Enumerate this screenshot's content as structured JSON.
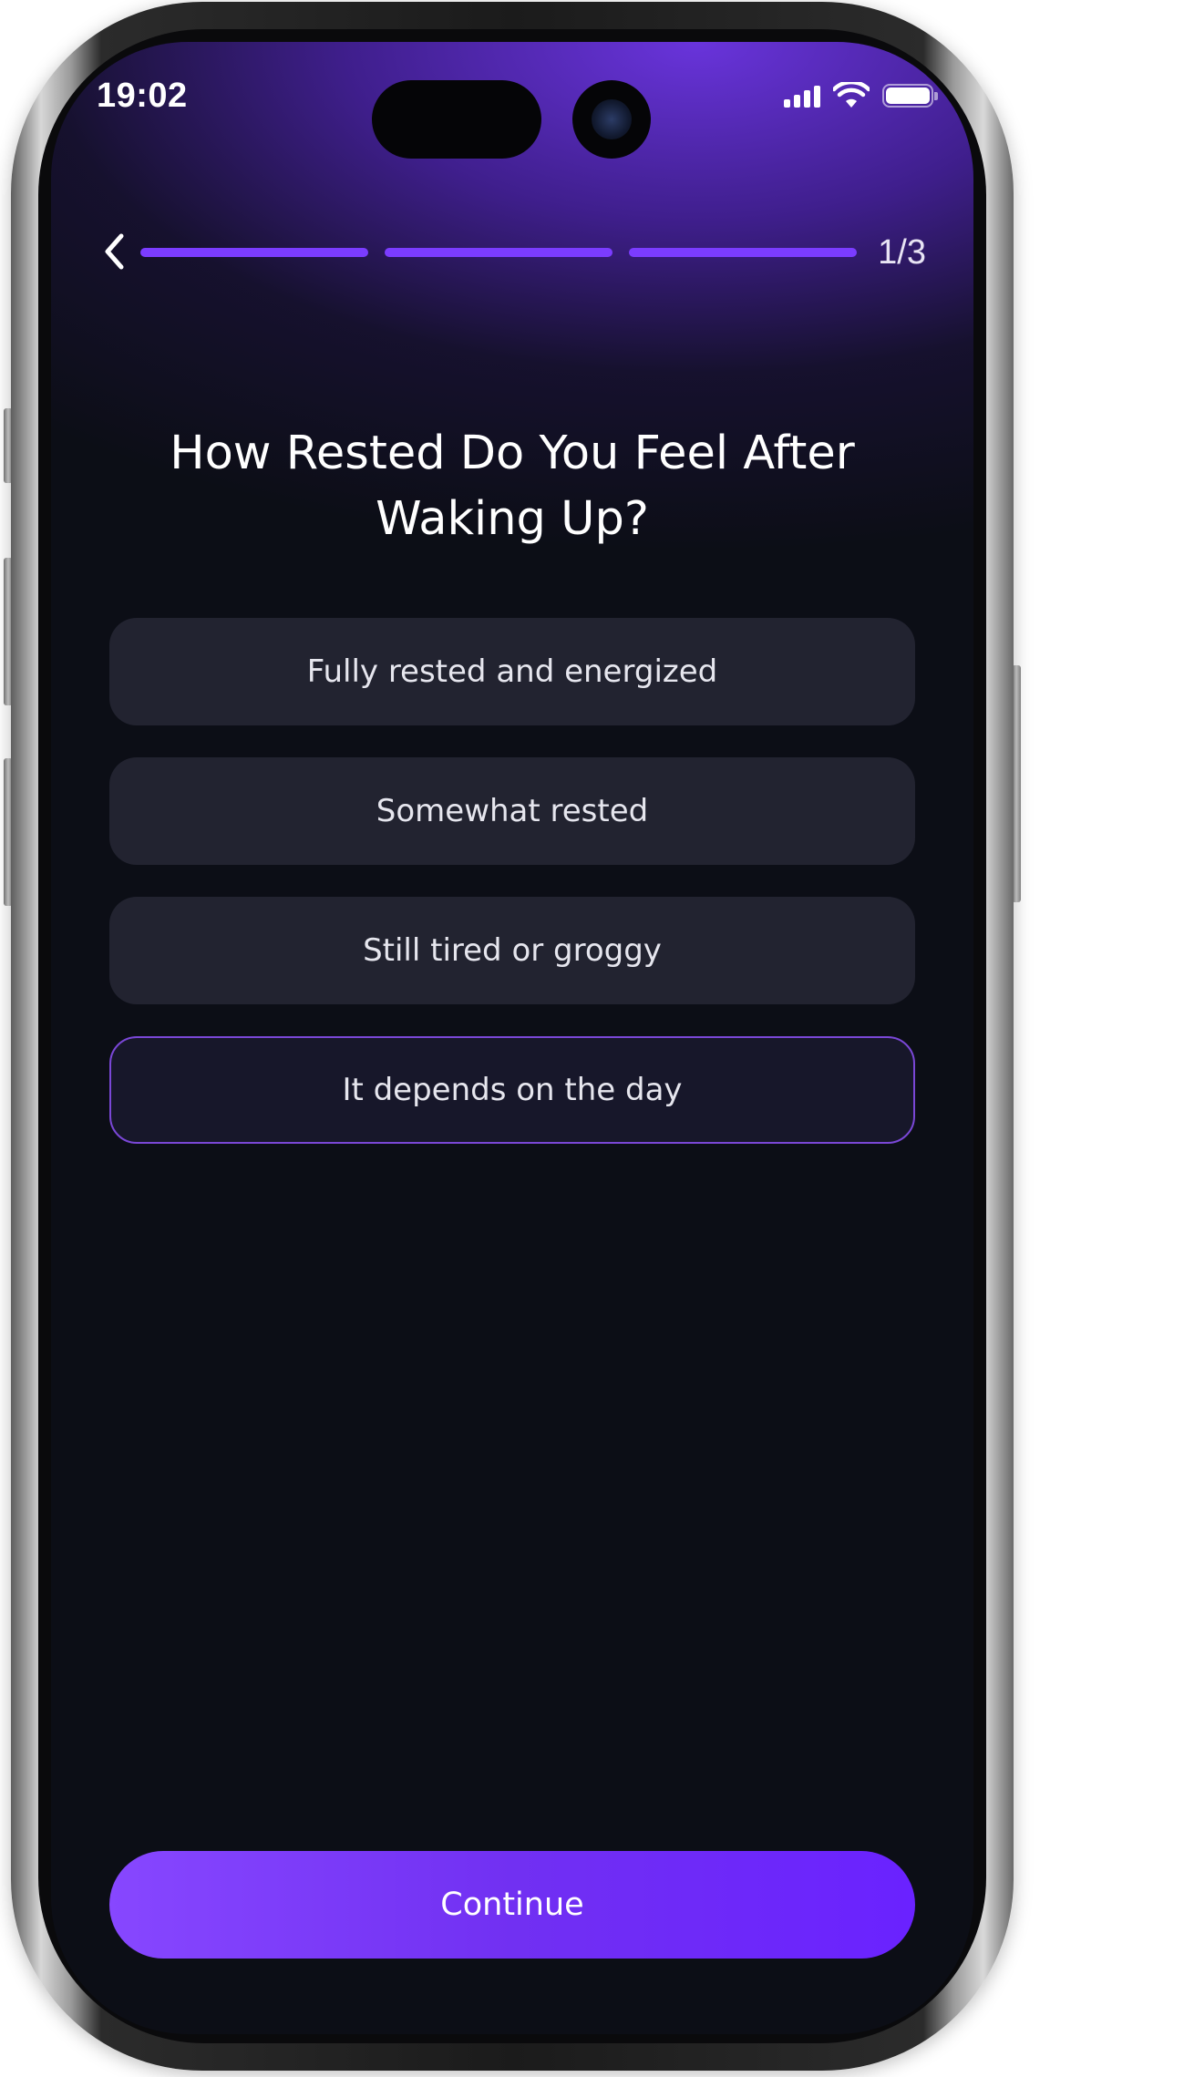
{
  "status_bar": {
    "time": "19:02",
    "battery_level": 1.0
  },
  "progress": {
    "step_label": "1/3",
    "segments": [
      {
        "active": true
      },
      {
        "active": true
      },
      {
        "active": true
      }
    ],
    "back_icon": "chevron-left-icon"
  },
  "question": {
    "title": "How Rested Do You Feel After Waking Up?"
  },
  "options": [
    {
      "label": "Fully rested and energized",
      "selected": false
    },
    {
      "label": "Somewhat rested",
      "selected": false
    },
    {
      "label": "Still tired or groggy",
      "selected": false
    },
    {
      "label": "It depends on the day",
      "selected": true
    }
  ],
  "cta": {
    "continue_label": "Continue"
  },
  "colors": {
    "accent": "#7b3cff",
    "background": "#0c0e16",
    "option_bg": "#262734",
    "selected_border": "#7a47d6"
  }
}
